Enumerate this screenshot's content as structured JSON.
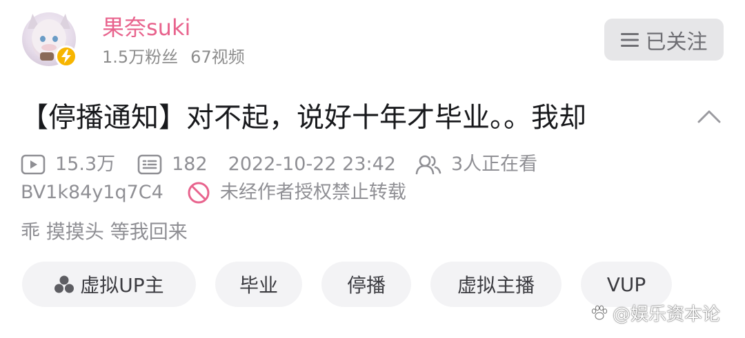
{
  "uploader": {
    "name": "果奈suki",
    "followers": "1.5万粉丝",
    "videos": "67视频"
  },
  "follow_button": {
    "label": "已关注"
  },
  "video": {
    "title": "【停播通知】对不起，说好十年才毕业。。我却",
    "views": "15.3万",
    "danmaku": "182",
    "datetime": "2022-10-22 23:42",
    "watching": "3人正在看",
    "bvid": "BV1k84y1q7C4",
    "reprint_notice": "未经作者授权禁止转载",
    "description": "乖 摸摸头 等我回来"
  },
  "tags": [
    "虚拟UP主",
    "毕业",
    "停播",
    "虚拟主播",
    "VUP"
  ],
  "watermark": "@娱乐资本论",
  "colors": {
    "username": "#e8638d",
    "badge": "#f7b500",
    "ban_icon": "#e8638d",
    "text_primary": "#18191c",
    "text_secondary": "#8f8f94"
  },
  "icons": {
    "badge": "lightning-icon",
    "follow": "menu-icon",
    "collapse": "chevron-up-icon",
    "views": "play-icon",
    "danmaku": "danmaku-icon",
    "watching": "people-icon",
    "reprint": "ban-icon",
    "first_tag": "cluster-icon",
    "watermark": "paw-icon"
  }
}
